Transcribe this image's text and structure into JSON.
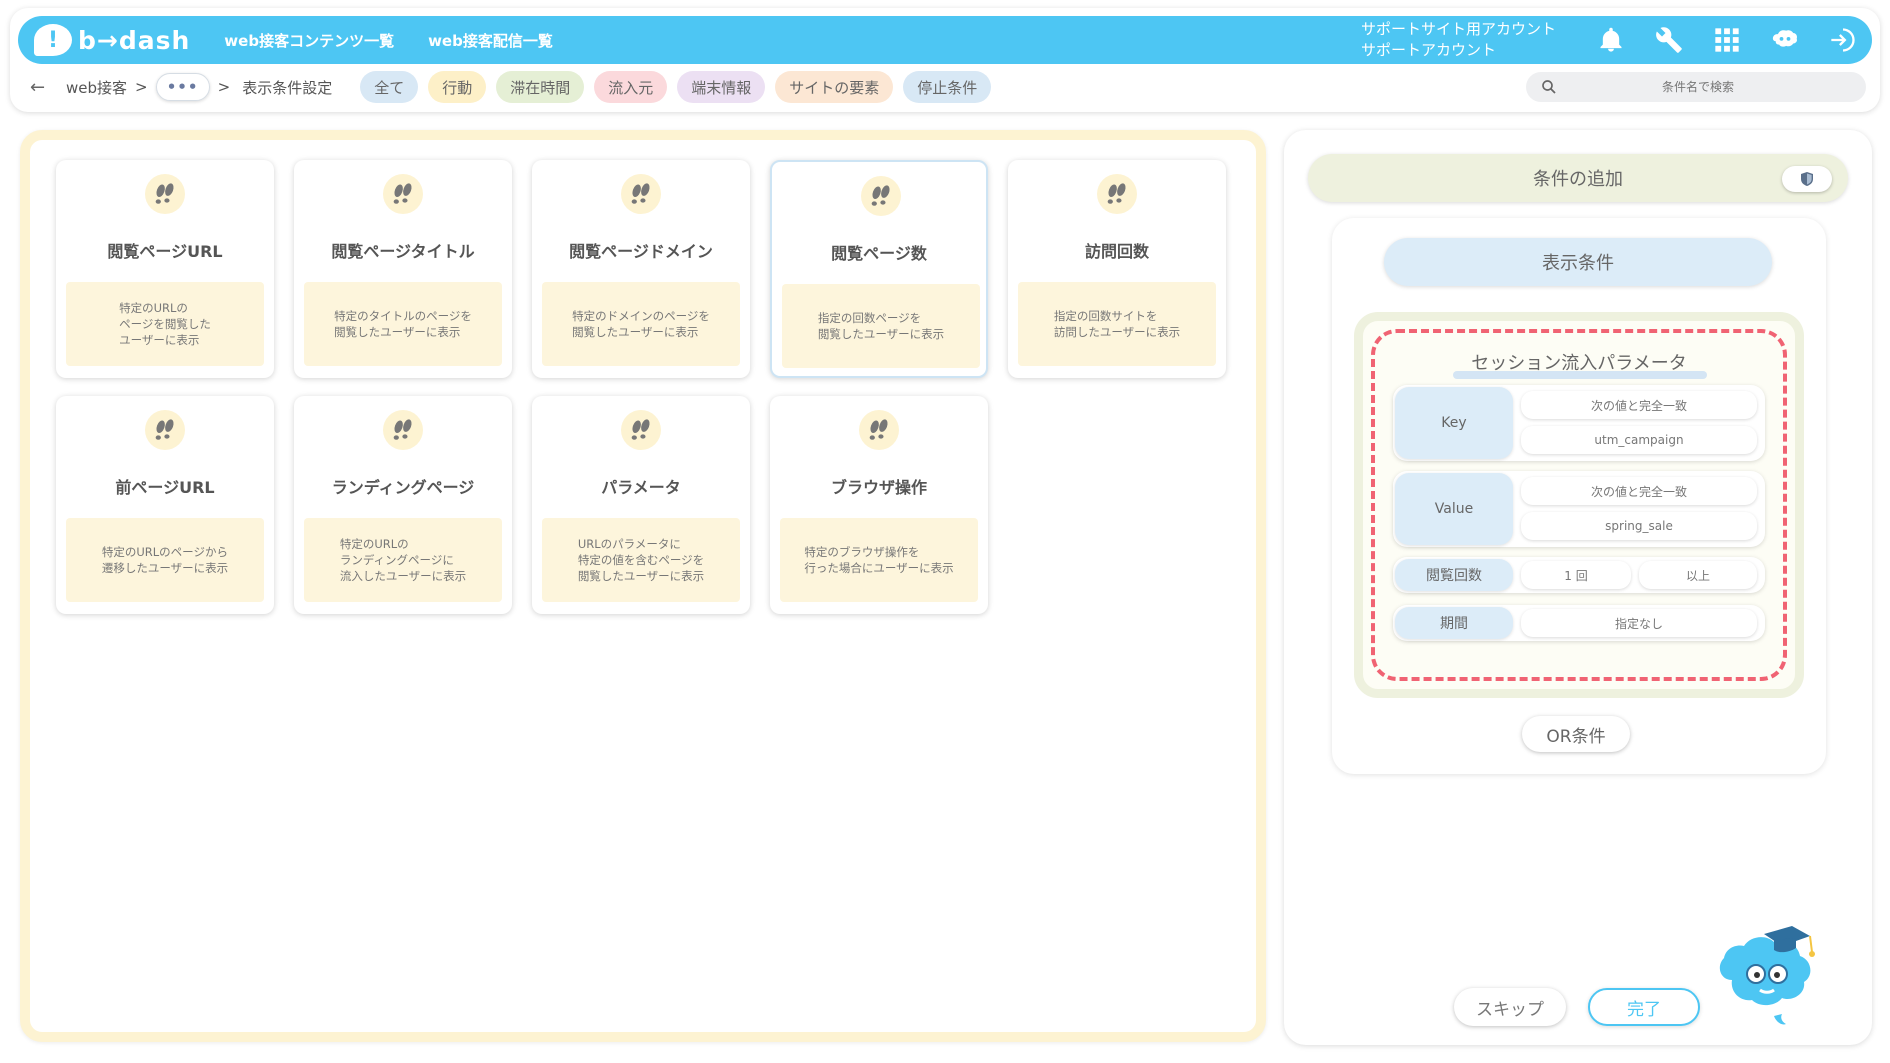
{
  "header": {
    "logo_text": "b→dash",
    "logo_mark": "!",
    "nav": [
      "web接客コンテンツ一覧",
      "web接客配信一覧"
    ],
    "account_line1": "サポートサイト用アカウント",
    "account_line2": "サポートアカウント",
    "icons": [
      "bell-icon",
      "wrench-icon",
      "apps-grid-icon",
      "mascot-icon",
      "logout-icon"
    ]
  },
  "breadcrumb": {
    "back": "←",
    "root": "web接客",
    "sep1": ">",
    "more": "•••",
    "sep2": ">",
    "current": "表示条件設定"
  },
  "filter_tabs": [
    {
      "label": "全て",
      "color": "#d8e8f5"
    },
    {
      "label": "行動",
      "color": "#fdf0c8"
    },
    {
      "label": "滞在時間",
      "color": "#e5efd5"
    },
    {
      "label": "流入元",
      "color": "#fbd9dc"
    },
    {
      "label": "端末情報",
      "color": "#ece0f3"
    },
    {
      "label": "サイトの要素",
      "color": "#fce7d4"
    },
    {
      "label": "停止条件",
      "color": "#d8e8f5"
    }
  ],
  "search": {
    "placeholder": "条件名で検索"
  },
  "cards": [
    {
      "title": "閲覧ページURL",
      "desc": "特定のURLの\nページを閲覧した\nユーザーに表示"
    },
    {
      "title": "閲覧ページタイトル",
      "desc": "特定のタイトルのページを\n閲覧したユーザーに表示"
    },
    {
      "title": "閲覧ページドメイン",
      "desc": "特定のドメインのページを\n閲覧したユーザーに表示"
    },
    {
      "title": "閲覧ページ数",
      "desc": "指定の回数ページを\n閲覧したユーザーに表示"
    },
    {
      "title": "訪問回数",
      "desc": "指定の回数サイトを\n訪問したユーザーに表示"
    },
    {
      "title": "前ページURL",
      "desc": "特定のURLのページから\n遷移したユーザーに表示"
    },
    {
      "title": "ランディングページ",
      "desc": "特定のURLの\nランディングページに\n流入したユーザーに表示"
    },
    {
      "title": "パラメータ",
      "desc": "URLのパラメータに\n特定の値を含むページを\n閲覧したユーザーに表示"
    },
    {
      "title": "ブラウザ操作",
      "desc": "特定のブラウザ操作を\n行った場合にユーザーに表示"
    }
  ],
  "right": {
    "add_condition": "条件の追加",
    "display_condition": "表示条件",
    "session_title": "セッション流入パラメータ",
    "key_label": "Key",
    "key_match": "次の値と完全一致",
    "key_value": "utm_campaign",
    "value_label": "Value",
    "value_match": "次の値と完全一致",
    "value_value": "spring_sale",
    "views_label": "閲覧回数",
    "views_count": "1 回",
    "views_cmp": "以上",
    "period_label": "期間",
    "period_value": "指定なし",
    "or_button": "OR条件",
    "skip_button": "スキップ",
    "done_button": "完了"
  }
}
